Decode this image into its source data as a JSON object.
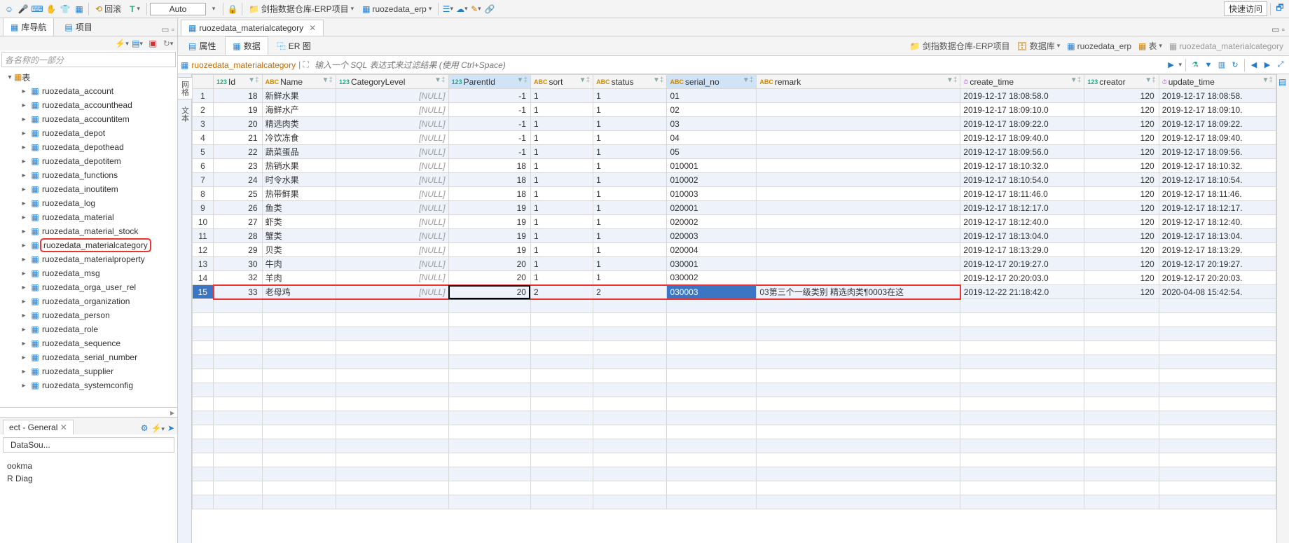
{
  "toolbar": {
    "rollback_label": "回滚",
    "t_label": "T",
    "auto_label": "Auto",
    "project_label": "剑指数据仓库-ERP项目",
    "schema_label": "ruozedata_erp",
    "quick_access": "快速访问"
  },
  "left_panel": {
    "nav_tab": "库导航",
    "project_tab": "项目",
    "filter_placeholder": "各名称的一部分",
    "tree_root": "表",
    "tables": [
      "ruozedata_account",
      "ruozedata_accounthead",
      "ruozedata_accountitem",
      "ruozedata_depot",
      "ruozedata_depothead",
      "ruozedata_depotitem",
      "ruozedata_functions",
      "ruozedata_inoutitem",
      "ruozedata_log",
      "ruozedata_material",
      "ruozedata_material_stock",
      "ruozedata_materialcategory",
      "ruozedata_materialproperty",
      "ruozedata_msg",
      "ruozedata_orga_user_rel",
      "ruozedata_organization",
      "ruozedata_person",
      "ruozedata_role",
      "ruozedata_sequence",
      "ruozedata_serial_number",
      "ruozedata_supplier",
      "ruozedata_systemconfig"
    ],
    "highlighted": "ruozedata_materialcategory",
    "bottom_tab": "ect - General",
    "bottom_sub": "DataSou...",
    "bottom_items": [
      "ookma",
      "R Diag"
    ]
  },
  "editor": {
    "tab_title": "ruozedata_materialcategory",
    "sub_tabs": {
      "props": "属性",
      "data": "数据",
      "er": "ER 图"
    },
    "breadcrumb": {
      "project": "剑指数据仓库-ERP项目",
      "db": "数据库",
      "schema": "ruozedata_erp",
      "tables": "表",
      "table": "ruozedata_materialcategory"
    },
    "filter_label": "ruozedata_materialcategory",
    "filter_placeholder": "输入一个 SQL 表达式来过滤结果 (使用 Ctrl+Space)",
    "side_tabs": {
      "grid": "网格",
      "text": "文本"
    }
  },
  "columns": [
    {
      "name": "Id",
      "type": "num"
    },
    {
      "name": "Name",
      "type": "txt"
    },
    {
      "name": "CategoryLevel",
      "type": "num"
    },
    {
      "name": "ParentId",
      "type": "num",
      "sorted": true
    },
    {
      "name": "sort",
      "type": "txt"
    },
    {
      "name": "status",
      "type": "txt"
    },
    {
      "name": "serial_no",
      "type": "txt",
      "sorted": true
    },
    {
      "name": "remark",
      "type": "txt"
    },
    {
      "name": "create_time",
      "type": "date"
    },
    {
      "name": "creator",
      "type": "num"
    },
    {
      "name": "update_time",
      "type": "date"
    }
  ],
  "rows": [
    {
      "n": 1,
      "Id": 18,
      "Name": "新鲜水果",
      "CategoryLevel": "[NULL]",
      "ParentId": -1,
      "sort": "1",
      "status": "1",
      "serial_no": "01",
      "remark": "",
      "create_time": "2019-12-17 18:08:58.0",
      "creator": 120,
      "update_time": "2019-12-17 18:08:58."
    },
    {
      "n": 2,
      "Id": 19,
      "Name": "海鲜水产",
      "CategoryLevel": "[NULL]",
      "ParentId": -1,
      "sort": "1",
      "status": "1",
      "serial_no": "02",
      "remark": "",
      "create_time": "2019-12-17 18:09:10.0",
      "creator": 120,
      "update_time": "2019-12-17 18:09:10."
    },
    {
      "n": 3,
      "Id": 20,
      "Name": "精选肉类",
      "CategoryLevel": "[NULL]",
      "ParentId": -1,
      "sort": "1",
      "status": "1",
      "serial_no": "03",
      "remark": "",
      "create_time": "2019-12-17 18:09:22.0",
      "creator": 120,
      "update_time": "2019-12-17 18:09:22."
    },
    {
      "n": 4,
      "Id": 21,
      "Name": "冷饮冻食",
      "CategoryLevel": "[NULL]",
      "ParentId": -1,
      "sort": "1",
      "status": "1",
      "serial_no": "04",
      "remark": "",
      "create_time": "2019-12-17 18:09:40.0",
      "creator": 120,
      "update_time": "2019-12-17 18:09:40."
    },
    {
      "n": 5,
      "Id": 22,
      "Name": "蔬菜蛋品",
      "CategoryLevel": "[NULL]",
      "ParentId": -1,
      "sort": "1",
      "status": "1",
      "serial_no": "05",
      "remark": "",
      "create_time": "2019-12-17 18:09:56.0",
      "creator": 120,
      "update_time": "2019-12-17 18:09:56."
    },
    {
      "n": 6,
      "Id": 23,
      "Name": "热销水果",
      "CategoryLevel": "[NULL]",
      "ParentId": 18,
      "sort": "1",
      "status": "1",
      "serial_no": "010001",
      "remark": "",
      "create_time": "2019-12-17 18:10:32.0",
      "creator": 120,
      "update_time": "2019-12-17 18:10:32."
    },
    {
      "n": 7,
      "Id": 24,
      "Name": "时令水果",
      "CategoryLevel": "[NULL]",
      "ParentId": 18,
      "sort": "1",
      "status": "1",
      "serial_no": "010002",
      "remark": "",
      "create_time": "2019-12-17 18:10:54.0",
      "creator": 120,
      "update_time": "2019-12-17 18:10:54."
    },
    {
      "n": 8,
      "Id": 25,
      "Name": "热带鲜果",
      "CategoryLevel": "[NULL]",
      "ParentId": 18,
      "sort": "1",
      "status": "1",
      "serial_no": "010003",
      "remark": "",
      "create_time": "2019-12-17 18:11:46.0",
      "creator": 120,
      "update_time": "2019-12-17 18:11:46."
    },
    {
      "n": 9,
      "Id": 26,
      "Name": "鱼类",
      "CategoryLevel": "[NULL]",
      "ParentId": 19,
      "sort": "1",
      "status": "1",
      "serial_no": "020001",
      "remark": "",
      "create_time": "2019-12-17 18:12:17.0",
      "creator": 120,
      "update_time": "2019-12-17 18:12:17."
    },
    {
      "n": 10,
      "Id": 27,
      "Name": "虾类",
      "CategoryLevel": "[NULL]",
      "ParentId": 19,
      "sort": "1",
      "status": "1",
      "serial_no": "020002",
      "remark": "",
      "create_time": "2019-12-17 18:12:40.0",
      "creator": 120,
      "update_time": "2019-12-17 18:12:40."
    },
    {
      "n": 11,
      "Id": 28,
      "Name": "蟹类",
      "CategoryLevel": "[NULL]",
      "ParentId": 19,
      "sort": "1",
      "status": "1",
      "serial_no": "020003",
      "remark": "",
      "create_time": "2019-12-17 18:13:04.0",
      "creator": 120,
      "update_time": "2019-12-17 18:13:04."
    },
    {
      "n": 12,
      "Id": 29,
      "Name": "贝类",
      "CategoryLevel": "[NULL]",
      "ParentId": 19,
      "sort": "1",
      "status": "1",
      "serial_no": "020004",
      "remark": "",
      "create_time": "2019-12-17 18:13:29.0",
      "creator": 120,
      "update_time": "2019-12-17 18:13:29."
    },
    {
      "n": 13,
      "Id": 30,
      "Name": "牛肉",
      "CategoryLevel": "[NULL]",
      "ParentId": 20,
      "sort": "1",
      "status": "1",
      "serial_no": "030001",
      "remark": "",
      "create_time": "2019-12-17 20:19:27.0",
      "creator": 120,
      "update_time": "2019-12-17 20:19:27."
    },
    {
      "n": 14,
      "Id": 32,
      "Name": "羊肉",
      "CategoryLevel": "[NULL]",
      "ParentId": 20,
      "sort": "1",
      "status": "1",
      "serial_no": "030002",
      "remark": "",
      "create_time": "2019-12-17 20:20:03.0",
      "creator": 120,
      "update_time": "2019-12-17 20:20:03."
    },
    {
      "n": 15,
      "Id": 33,
      "Name": "老母鸡",
      "CategoryLevel": "[NULL]",
      "ParentId": 20,
      "sort": "2",
      "status": "2",
      "serial_no": "030003",
      "remark": "03第三个一级类别 精选肉类¶0003在这",
      "create_time": "2019-12-22 21:18:42.0",
      "creator": 120,
      "update_time": "2020-04-08 15:42:54."
    }
  ]
}
